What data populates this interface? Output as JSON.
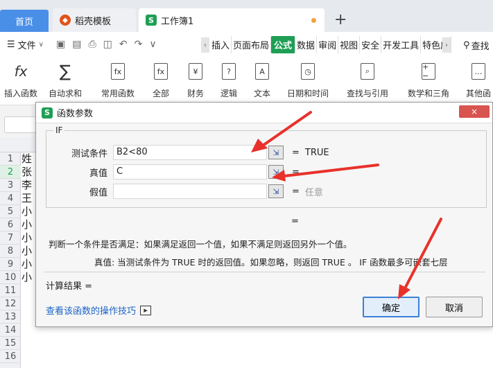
{
  "tabs": {
    "home": "首页",
    "doc": "稻壳模板",
    "workbook": "工作簿1"
  },
  "menu": {
    "file": "文件",
    "ribbon_tabs": [
      "插入",
      "页面布局",
      "公式",
      "数据",
      "审阅",
      "视图",
      "安全",
      "开发工具",
      "特色应"
    ],
    "active_tab": "公式",
    "search": "查找"
  },
  "ribbon": {
    "buttons": [
      {
        "label": "插入函数",
        "icon": "fx-icon",
        "glyph": "fx"
      },
      {
        "label": "自动求和",
        "icon": "sigma-icon",
        "glyph": "∑"
      },
      {
        "label": "常用函数",
        "icon": "star-fx-icon",
        "glyph": "fx"
      },
      {
        "label": "全部",
        "icon": "all-fx-icon",
        "glyph": "fx"
      },
      {
        "label": "财务",
        "icon": "finance-icon",
        "glyph": "¥"
      },
      {
        "label": "逻辑",
        "icon": "logic-icon",
        "glyph": "?"
      },
      {
        "label": "文本",
        "icon": "text-icon",
        "glyph": "A"
      },
      {
        "label": "日期和时间",
        "icon": "clock-icon",
        "glyph": "◷"
      },
      {
        "label": "查找与引用",
        "icon": "lookup-icon",
        "glyph": "⌕"
      },
      {
        "label": "数学和三角",
        "icon": "math-icon",
        "glyph": "+−"
      },
      {
        "label": "其他函",
        "icon": "other-fx-icon",
        "glyph": "…"
      }
    ]
  },
  "sheet": {
    "rows": [
      "1",
      "2",
      "3",
      "4",
      "5",
      "6",
      "7",
      "8",
      "9",
      "10",
      "11",
      "12",
      "13",
      "14",
      "15",
      "16"
    ],
    "col_a": [
      "姓",
      "张",
      "李",
      "王",
      "小",
      "小",
      "小",
      "小",
      "小",
      "小"
    ]
  },
  "dialog": {
    "title": "函数参数",
    "close": "×",
    "function_name": "IF",
    "args": [
      {
        "label": "测试条件",
        "value": "B2<80",
        "result": "TRUE",
        "hint": false
      },
      {
        "label": "真值",
        "value": "C",
        "result": "",
        "hint": false
      },
      {
        "label": "假值",
        "value": "",
        "result": "任意",
        "hint": true
      }
    ],
    "eq": "=",
    "result_eq": "=",
    "description": "判断一个条件是否满足：如果满足返回一个值，如果不满足则返回另外一个值。",
    "param_description": "真值:  当测试条件为 TRUE 时的返回值。如果忽略，则返回 TRUE 。 IF 函数最多可嵌套七层",
    "calc_result": "计算结果 =",
    "help_link": "查看该函数的操作技巧",
    "ok": "确定",
    "cancel": "取消"
  },
  "colors": {
    "accent_green": "#1e9f55",
    "home_tab": "#4a8fe7",
    "arrow_red": "#e8312a",
    "link_blue": "#1a63c8"
  }
}
